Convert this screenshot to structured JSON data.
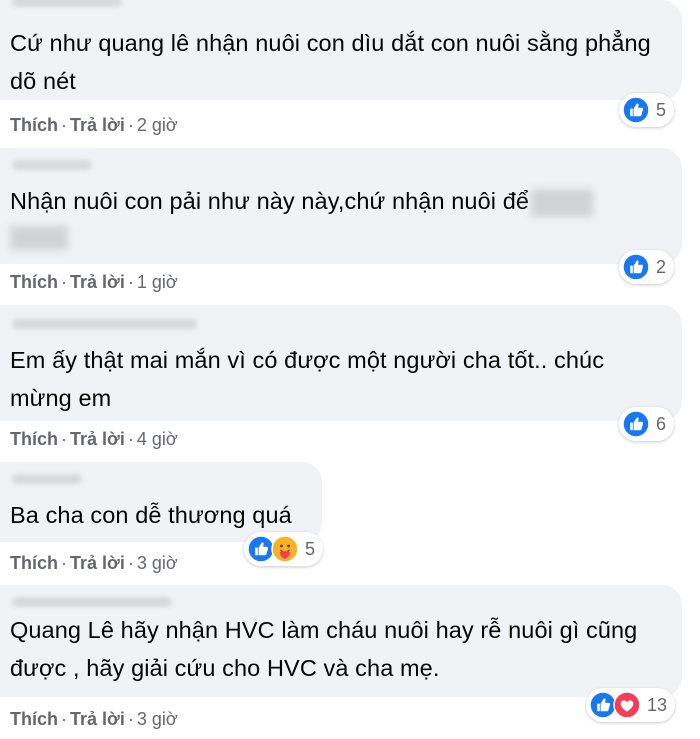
{
  "comments": [
    {
      "text": "Cứ như quang lê nhận nuôi con dìu dắt con nuôi sằng phẳng dõ nét",
      "like": "Thích",
      "reply": "Trả lời",
      "time": "2 giờ",
      "reactions": [
        "like"
      ],
      "reaction_count": "5"
    },
    {
      "text": "Nhận nuôi con pải như này này,chứ nhận nuôi để",
      "like": "Thích",
      "reply": "Trả lời",
      "time": "1 giờ",
      "reactions": [
        "like"
      ],
      "reaction_count": "2"
    },
    {
      "text": "Em ấy thật mai mắn vì có được một người cha tốt.. chúc mừng em",
      "like": "Thích",
      "reply": "Trả lời",
      "time": "4 giờ",
      "reactions": [
        "like"
      ],
      "reaction_count": "6"
    },
    {
      "text": "Ba cha con dễ thương quá",
      "like": "Thích",
      "reply": "Trả lời",
      "time": "3 giờ",
      "reactions": [
        "like",
        "care"
      ],
      "reaction_count": "5"
    },
    {
      "text": "Quang Lê hãy nhận HVC làm cháu nuôi hay rễ nuôi gì cũng được , hãy giải cứu cho HVC và cha mẹ.",
      "like": "Thích",
      "reply": "Trả lời",
      "time": "3 giờ",
      "reactions": [
        "like",
        "love"
      ],
      "reaction_count": "13"
    }
  ],
  "colors": {
    "bubble": "#f0f2f5",
    "secondary_text": "#65676b",
    "like_blue": "#1877f2",
    "love_red": "#f33e58",
    "care_yellow": "#f7b125"
  }
}
